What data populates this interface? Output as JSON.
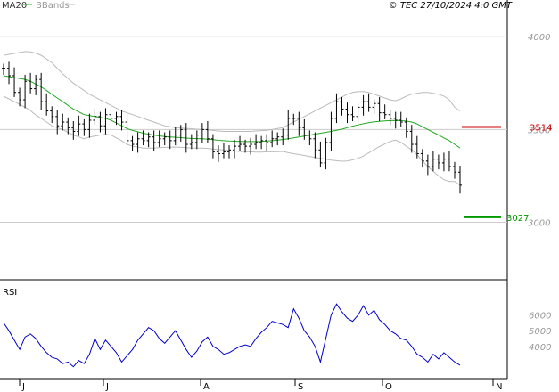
{
  "legend": {
    "ma_label": "MA20",
    "bands_label": "BBands",
    "ma_color": "#22aa22",
    "bands_color": "#bbbbbb"
  },
  "copyright": "© TEC 27/10/2024 4:0 GMT",
  "chart_data": [
    {
      "type": "ohlc",
      "y_axis_ticks": [
        "4000",
        "3500",
        "3000"
      ],
      "ylim": [
        2700,
        4150
      ],
      "grid": true,
      "x_month_ticks": [
        "J",
        "J",
        "A",
        "S",
        "O",
        "N"
      ],
      "levels": [
        {
          "label": "3514",
          "value": 3514,
          "color": "#cc0000"
        },
        {
          "label": "3027",
          "value": 3027,
          "color": "#009900"
        }
      ],
      "price_close": [
        3830,
        3790,
        3700,
        3660,
        3760,
        3720,
        3770,
        3650,
        3600,
        3570,
        3520,
        3540,
        3510,
        3490,
        3530,
        3500,
        3550,
        3570,
        3520,
        3580,
        3560,
        3570,
        3540,
        3440,
        3420,
        3450,
        3440,
        3460,
        3430,
        3450,
        3460,
        3440,
        3470,
        3500,
        3420,
        3430,
        3470,
        3500,
        3450,
        3380,
        3370,
        3380,
        3390,
        3410,
        3420,
        3410,
        3420,
        3430,
        3440,
        3430,
        3450,
        3460,
        3470,
        3560,
        3560,
        3510,
        3470,
        3450,
        3390,
        3320,
        3430,
        3560,
        3650,
        3610,
        3580,
        3570,
        3620,
        3650,
        3620,
        3640,
        3590,
        3580,
        3560,
        3550,
        3540,
        3490,
        3420,
        3370,
        3330,
        3300,
        3340,
        3320,
        3340,
        3300,
        3270,
        3200
      ],
      "ma20": [
        3790,
        3785,
        3780,
        3775,
        3770,
        3760,
        3745,
        3730,
        3710,
        3690,
        3670,
        3650,
        3630,
        3610,
        3595,
        3580,
        3575,
        3570,
        3565,
        3560,
        3550,
        3535,
        3520,
        3505,
        3495,
        3488,
        3480,
        3475,
        3470,
        3466,
        3462,
        3460,
        3458,
        3456,
        3454,
        3452,
        3451,
        3450,
        3448,
        3445,
        3442,
        3440,
        3438,
        3437,
        3436,
        3435,
        3435,
        3435,
        3436,
        3438,
        3440,
        3443,
        3446,
        3450,
        3455,
        3460,
        3465,
        3470,
        3475,
        3480,
        3485,
        3490,
        3496,
        3502,
        3510,
        3518,
        3525,
        3531,
        3537,
        3541,
        3544,
        3546,
        3548,
        3549,
        3548,
        3545,
        3540,
        3530,
        3515,
        3500,
        3485,
        3470,
        3455,
        3440,
        3420,
        3400
      ],
      "bb_upper": [
        3900,
        3905,
        3910,
        3915,
        3920,
        3918,
        3912,
        3900,
        3880,
        3860,
        3830,
        3800,
        3775,
        3750,
        3730,
        3710,
        3690,
        3675,
        3660,
        3645,
        3630,
        3615,
        3600,
        3590,
        3580,
        3570,
        3560,
        3550,
        3540,
        3530,
        3520,
        3515,
        3510,
        3508,
        3506,
        3504,
        3502,
        3500,
        3498,
        3495,
        3492,
        3490,
        3490,
        3490,
        3490,
        3490,
        3490,
        3492,
        3494,
        3496,
        3500,
        3505,
        3510,
        3525,
        3540,
        3555,
        3570,
        3585,
        3600,
        3615,
        3630,
        3645,
        3660,
        3675,
        3690,
        3700,
        3705,
        3705,
        3700,
        3690,
        3680,
        3670,
        3660,
        3655,
        3665,
        3680,
        3690,
        3695,
        3700,
        3700,
        3695,
        3690,
        3680,
        3660,
        3620,
        3600
      ],
      "bb_lower": [
        3680,
        3665,
        3650,
        3635,
        3620,
        3602,
        3578,
        3560,
        3540,
        3520,
        3510,
        3500,
        3485,
        3470,
        3460,
        3450,
        3460,
        3465,
        3470,
        3475,
        3470,
        3455,
        3440,
        3420,
        3410,
        3406,
        3400,
        3400,
        3400,
        3402,
        3404,
        3405,
        3406,
        3404,
        3402,
        3400,
        3400,
        3400,
        3398,
        3395,
        3392,
        3390,
        3386,
        3384,
        3382,
        3380,
        3380,
        3378,
        3378,
        3380,
        3380,
        3381,
        3382,
        3375,
        3370,
        3365,
        3360,
        3355,
        3350,
        3345,
        3340,
        3335,
        3332,
        3329,
        3330,
        3336,
        3345,
        3357,
        3374,
        3392,
        3408,
        3422,
        3436,
        3443,
        3431,
        3410,
        3390,
        3365,
        3330,
        3300,
        3275,
        3250,
        3230,
        3220,
        3220,
        3200
      ]
    },
    {
      "type": "line",
      "title": "RSI",
      "y_axis_ticks": [
        "6000",
        "5000",
        "4000"
      ],
      "ylim": [
        20,
        78
      ],
      "x_month_ticks": [
        "J",
        "J",
        "A",
        "S",
        "O",
        "N"
      ],
      "series": [
        {
          "values": [
            55,
            50,
            44,
            38,
            46,
            48,
            45,
            40,
            36,
            33,
            32,
            29,
            30,
            27,
            31,
            29,
            35,
            45,
            38,
            44,
            40,
            36,
            30,
            34,
            38,
            44,
            48,
            52,
            50,
            45,
            42,
            46,
            50,
            44,
            38,
            33,
            37,
            43,
            46,
            40,
            38,
            35,
            36,
            38,
            40,
            41,
            40,
            45,
            49,
            52,
            56,
            55,
            54,
            52,
            64,
            58,
            50,
            46,
            40,
            30,
            45,
            60,
            67,
            62,
            58,
            56,
            60,
            66,
            60,
            63,
            57,
            54,
            50,
            48,
            45,
            44,
            40,
            35,
            33,
            30,
            35,
            32,
            36,
            33,
            30,
            28
          ]
        }
      ]
    }
  ]
}
